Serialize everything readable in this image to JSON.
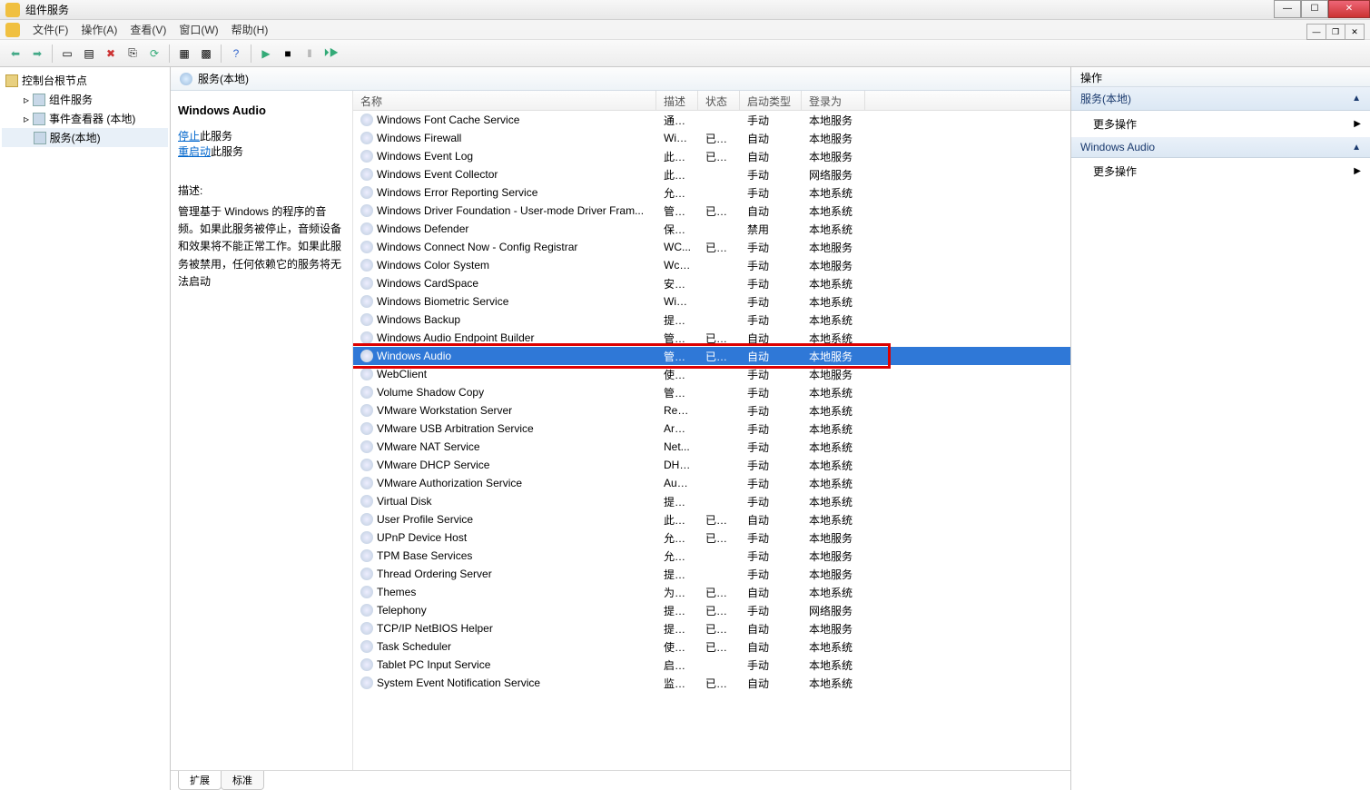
{
  "window": {
    "title": "组件服务"
  },
  "menu": {
    "file": "文件(F)",
    "action": "操作(A)",
    "view": "查看(V)",
    "window": "窗口(W)",
    "help": "帮助(H)"
  },
  "tree": {
    "root": "控制台根节点",
    "items": [
      "组件服务",
      "事件查看器 (本地)",
      "服务(本地)"
    ]
  },
  "pane": {
    "title": "服务(本地)"
  },
  "detail": {
    "selected_name": "Windows Audio",
    "stop_link": "停止",
    "stop_suffix": "此服务",
    "restart_link": "重启动",
    "restart_suffix": "此服务",
    "desc_label": "描述:",
    "desc_text": "管理基于 Windows 的程序的音频。如果此服务被停止，音频设备和效果将不能正常工作。如果此服务被禁用，任何依赖它的服务将无法启动"
  },
  "columns": {
    "name": "名称",
    "desc": "描述",
    "status": "状态",
    "start": "启动类型",
    "logon": "登录为"
  },
  "selected_index": 13,
  "services": [
    {
      "name": "Windows Font Cache Service",
      "desc": "通过...",
      "status": "",
      "start": "手动",
      "logon": "本地服务"
    },
    {
      "name": "Windows Firewall",
      "desc": "Win...",
      "status": "已启动",
      "start": "自动",
      "logon": "本地服务"
    },
    {
      "name": "Windows Event Log",
      "desc": "此服...",
      "status": "已启动",
      "start": "自动",
      "logon": "本地服务"
    },
    {
      "name": "Windows Event Collector",
      "desc": "此服...",
      "status": "",
      "start": "手动",
      "logon": "网络服务"
    },
    {
      "name": "Windows Error Reporting Service",
      "desc": "允许...",
      "status": "",
      "start": "手动",
      "logon": "本地系统"
    },
    {
      "name": "Windows Driver Foundation - User-mode Driver Fram...",
      "desc": "管理...",
      "status": "已启动",
      "start": "自动",
      "logon": "本地系统"
    },
    {
      "name": "Windows Defender",
      "desc": "保护...",
      "status": "",
      "start": "禁用",
      "logon": "本地系统"
    },
    {
      "name": "Windows Connect Now - Config Registrar",
      "desc": "WC...",
      "status": "已启动",
      "start": "手动",
      "logon": "本地服务"
    },
    {
      "name": "Windows Color System",
      "desc": "Wcs...",
      "status": "",
      "start": "手动",
      "logon": "本地服务"
    },
    {
      "name": "Windows CardSpace",
      "desc": "安全...",
      "status": "",
      "start": "手动",
      "logon": "本地系统"
    },
    {
      "name": "Windows Biometric Service",
      "desc": "Win...",
      "status": "",
      "start": "手动",
      "logon": "本地系统"
    },
    {
      "name": "Windows Backup",
      "desc": "提供...",
      "status": "",
      "start": "手动",
      "logon": "本地系统"
    },
    {
      "name": "Windows Audio Endpoint Builder",
      "desc": "管理...",
      "status": "已启动",
      "start": "自动",
      "logon": "本地系统"
    },
    {
      "name": "Windows Audio",
      "desc": "管理...",
      "status": "已启动",
      "start": "自动",
      "logon": "本地服务"
    },
    {
      "name": "WebClient",
      "desc": "使基...",
      "status": "",
      "start": "手动",
      "logon": "本地服务"
    },
    {
      "name": "Volume Shadow Copy",
      "desc": "管理...",
      "status": "",
      "start": "手动",
      "logon": "本地系统"
    },
    {
      "name": "VMware Workstation Server",
      "desc": "Rem...",
      "status": "",
      "start": "手动",
      "logon": "本地系统"
    },
    {
      "name": "VMware USB Arbitration Service",
      "desc": "Arbit...",
      "status": "",
      "start": "手动",
      "logon": "本地系统"
    },
    {
      "name": "VMware NAT Service",
      "desc": "Net...",
      "status": "",
      "start": "手动",
      "logon": "本地系统"
    },
    {
      "name": "VMware DHCP Service",
      "desc": "DHC...",
      "status": "",
      "start": "手动",
      "logon": "本地系统"
    },
    {
      "name": "VMware Authorization Service",
      "desc": "Auth...",
      "status": "",
      "start": "手动",
      "logon": "本地系统"
    },
    {
      "name": "Virtual Disk",
      "desc": "提供...",
      "status": "",
      "start": "手动",
      "logon": "本地系统"
    },
    {
      "name": "User Profile Service",
      "desc": "此服...",
      "status": "已启动",
      "start": "自动",
      "logon": "本地系统"
    },
    {
      "name": "UPnP Device Host",
      "desc": "允许...",
      "status": "已启动",
      "start": "手动",
      "logon": "本地服务"
    },
    {
      "name": "TPM Base Services",
      "desc": "允许...",
      "status": "",
      "start": "手动",
      "logon": "本地服务"
    },
    {
      "name": "Thread Ordering Server",
      "desc": "提供...",
      "status": "",
      "start": "手动",
      "logon": "本地服务"
    },
    {
      "name": "Themes",
      "desc": "为用...",
      "status": "已启动",
      "start": "自动",
      "logon": "本地系统"
    },
    {
      "name": "Telephony",
      "desc": "提供...",
      "status": "已启动",
      "start": "手动",
      "logon": "网络服务"
    },
    {
      "name": "TCP/IP NetBIOS Helper",
      "desc": "提供...",
      "status": "已启动",
      "start": "自动",
      "logon": "本地服务"
    },
    {
      "name": "Task Scheduler",
      "desc": "使用...",
      "status": "已启动",
      "start": "自动",
      "logon": "本地系统"
    },
    {
      "name": "Tablet PC Input Service",
      "desc": "启用...",
      "status": "",
      "start": "手动",
      "logon": "本地系统"
    },
    {
      "name": "System Event Notification Service",
      "desc": "监视...",
      "status": "已启动",
      "start": "自动",
      "logon": "本地系统"
    }
  ],
  "tabs": {
    "extended": "扩展",
    "standard": "标准"
  },
  "actions": {
    "header": "操作",
    "group1": "服务(本地)",
    "more1": "更多操作",
    "group2": "Windows Audio",
    "more2": "更多操作"
  }
}
